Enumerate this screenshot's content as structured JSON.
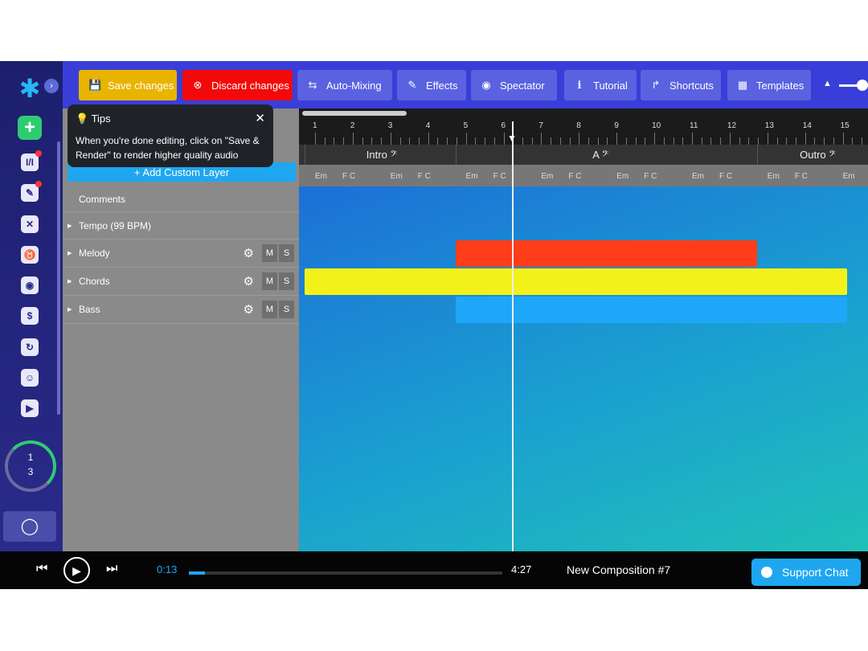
{
  "sidebar": {
    "icons": [
      "logo",
      "add",
      "lyrics",
      "edit",
      "tools",
      "trophy",
      "broadcast",
      "dollar",
      "history",
      "discord",
      "youtube"
    ],
    "progress": {
      "current": "1",
      "total": "3"
    }
  },
  "toolbar": {
    "buttons": [
      {
        "label": "Save changes",
        "icon": "save-icon",
        "color": "#e8b400"
      },
      {
        "label": "Discard changes",
        "icon": "close-circle-icon",
        "color": "#f20a0a"
      },
      {
        "label": "Auto-Mixing",
        "icon": "sliders-icon",
        "color": "#5a62e0"
      },
      {
        "label": "Effects",
        "icon": "wand-icon",
        "color": "#5a62e0"
      },
      {
        "label": "Spectator",
        "icon": "eye-icon",
        "color": "#5a62e0"
      },
      {
        "label": "Tutorial",
        "icon": "info-icon",
        "color": "#5a62e0"
      },
      {
        "label": "Shortcuts",
        "icon": "share-icon",
        "color": "#5a62e0"
      },
      {
        "label": "Templates",
        "icon": "grid-icon",
        "color": "#5a62e0"
      }
    ]
  },
  "tips": {
    "title": "Tips",
    "body": "When you're done editing, click on \"Save & Render\" to render higher quality audio"
  },
  "add_layer": "+ Add Custom Layer",
  "tracks": [
    {
      "name": "Comments",
      "expandable": false
    },
    {
      "name": "Tempo (99 BPM)",
      "expandable": true
    },
    {
      "name": "Melody",
      "expandable": true,
      "mute": "M",
      "solo": "S",
      "color": "#ff3d1a",
      "start": 5,
      "end": 13
    },
    {
      "name": "Chords",
      "expandable": true,
      "mute": "M",
      "solo": "S",
      "color": "#f2f21a",
      "start": 1,
      "end": 15.4
    },
    {
      "name": "Bass",
      "expandable": true,
      "mute": "M",
      "solo": "S",
      "color": "#1ea7f8",
      "start": 5,
      "end": 15.4
    }
  ],
  "ruler": {
    "measures": [
      "1",
      "2",
      "3",
      "4",
      "5",
      "6",
      "7",
      "8",
      "9",
      "10",
      "11",
      "12",
      "13",
      "14",
      "15"
    ],
    "playhead": 6.5
  },
  "sections": [
    {
      "label": "Intro",
      "start": 1,
      "end": 5
    },
    {
      "label": "A",
      "start": 5,
      "end": 13
    },
    {
      "label": "Outro",
      "start": 13,
      "end": 16
    }
  ],
  "chords": [
    "Em",
    "F C",
    "Em",
    "F C",
    "Em",
    "F C",
    "Em",
    "F C",
    "Em",
    "F C",
    "Em",
    "F C",
    "Em",
    "F C",
    "Em"
  ],
  "player": {
    "current": "0:13",
    "total": "4:27",
    "progress": 0.05,
    "title": "New Composition #7",
    "support": "Support Chat"
  }
}
